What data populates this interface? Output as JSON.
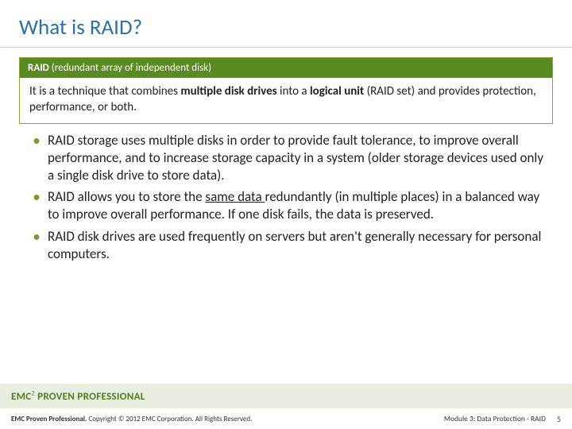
{
  "title": "What is RAID?",
  "defbox": {
    "head_bold": "RAID ",
    "head_rest": "(redundant array of independent disk)",
    "body_pre": "It is a technique that combines ",
    "body_bold1": "multiple disk drives",
    "body_mid": " into a ",
    "body_bold2": "logical unit",
    "body_post": " (RAID set) and provides protection, performance, or both."
  },
  "bullets": [
    {
      "text": "RAID storage uses multiple disks in order to provide fault tolerance, to improve overall performance, and to increase storage capacity in a system (older storage devices used only a single disk drive to store data)."
    },
    {
      "pre": "RAID allows you to store the ",
      "underline": "same data ",
      "post": "redundantly (in multiple places) in a balanced way to improve overall performance. If one disk fails, the data is preserved."
    },
    {
      "text": "RAID disk drives are used frequently on servers but aren't generally necessary for personal computers."
    }
  ],
  "footer1": {
    "brand_pre": "EMC",
    "brand_sup": "2",
    "brand_post": " PROVEN PROFESSIONAL"
  },
  "footer2": {
    "left_bold": "EMC Proven Professional.",
    "left_rest": " Copyright © 2012 EMC Corporation. All Rights Reserved.",
    "right_module": "Module 3: Data Protection - RAID",
    "page": "5"
  }
}
